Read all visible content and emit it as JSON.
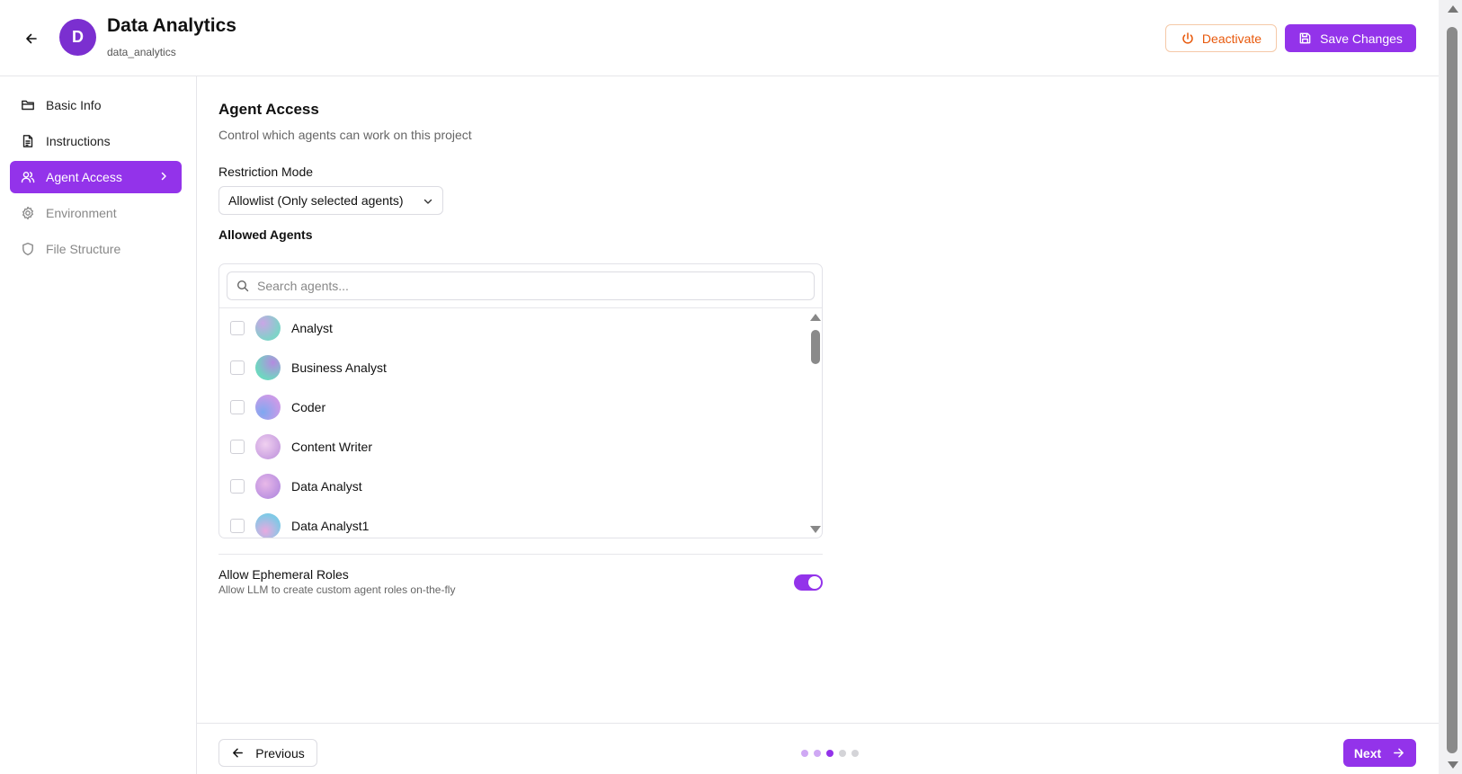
{
  "header": {
    "avatar_letter": "D",
    "title": "Data Analytics",
    "slug": "data_analytics",
    "deactivate_label": "Deactivate",
    "save_label": "Save Changes"
  },
  "sidebar": {
    "items": [
      {
        "label": "Basic Info",
        "icon": "folder-icon"
      },
      {
        "label": "Instructions",
        "icon": "document-icon"
      },
      {
        "label": "Agent Access",
        "icon": "users-icon"
      },
      {
        "label": "Environment",
        "icon": "gear-icon"
      },
      {
        "label": "File Structure",
        "icon": "shield-icon"
      }
    ]
  },
  "section": {
    "title": "Agent Access",
    "subtitle": "Control which agents can work on this project",
    "restriction_label": "Restriction Mode",
    "restriction_value": "Allowlist (Only selected agents)",
    "allowed_label": "Allowed Agents",
    "search_placeholder": "Search agents...",
    "agents": [
      {
        "name": "Analyst"
      },
      {
        "name": "Business Analyst"
      },
      {
        "name": "Coder"
      },
      {
        "name": "Content Writer"
      },
      {
        "name": "Data Analyst"
      },
      {
        "name": "Data Analyst1"
      }
    ],
    "ephemeral_title": "Allow Ephemeral Roles",
    "ephemeral_desc": "Allow LLM to create custom agent roles on-the-fly",
    "ephemeral_enabled": true
  },
  "footer": {
    "previous_label": "Previous",
    "next_label": "Next",
    "step_current": 3,
    "step_total": 5
  },
  "colors": {
    "accent": "#9333ea",
    "warning": "#e8590c"
  }
}
